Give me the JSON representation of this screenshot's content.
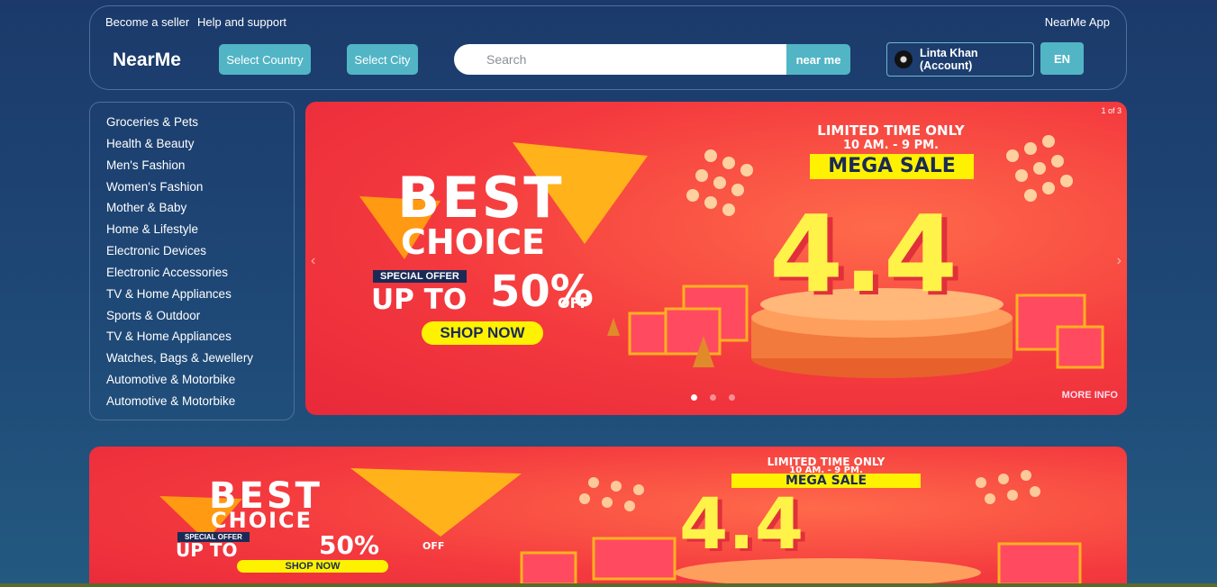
{
  "header": {
    "become_seller": "Become a seller",
    "help": "Help and support",
    "app": "NearMe App",
    "brand": "NearMe",
    "select_country": "Select Country",
    "select_city": "Select City",
    "search_placeholder": "Search",
    "search_button": "near me",
    "account": "Linta Khan (Account)",
    "lang": "EN"
  },
  "sidebar": {
    "items": [
      {
        "label": "Groceries & Pets"
      },
      {
        "label": "Health & Beauty"
      },
      {
        "label": "Men's Fashion"
      },
      {
        "label": "Women's Fashion"
      },
      {
        "label": "Mother & Baby"
      },
      {
        "label": "Home & Lifestyle"
      },
      {
        "label": "Electronic Devices"
      },
      {
        "label": "Electronic Accessories"
      },
      {
        "label": "TV & Home Appliances"
      },
      {
        "label": "Sports & Outdoor"
      },
      {
        "label": "TV & Home Appliances"
      },
      {
        "label": "Watches, Bags & Jewellery"
      },
      {
        "label": "Automotive & Motorbike"
      },
      {
        "label": "Automotive & Motorbike"
      }
    ]
  },
  "carousel": {
    "counter": "1 of 3",
    "prev": "‹",
    "next": "›",
    "banner": {
      "best": "BEST",
      "choice": "CHOICE",
      "special": "SPECIAL OFFER",
      "upto": "UP TO",
      "percent": "50%",
      "off": "OFF",
      "shop": "SHOP NOW",
      "limited": "LIMITED TIME ONLY",
      "hours": "10 AM. - 9 PM.",
      "mega": "MEGA SALE",
      "big": "4.4",
      "more": "MORE INFO"
    }
  },
  "colors": {
    "accent": "#52b5c5",
    "banner_red": "#f4393e",
    "yellow": "#fff200",
    "navy": "#1b2a55"
  }
}
